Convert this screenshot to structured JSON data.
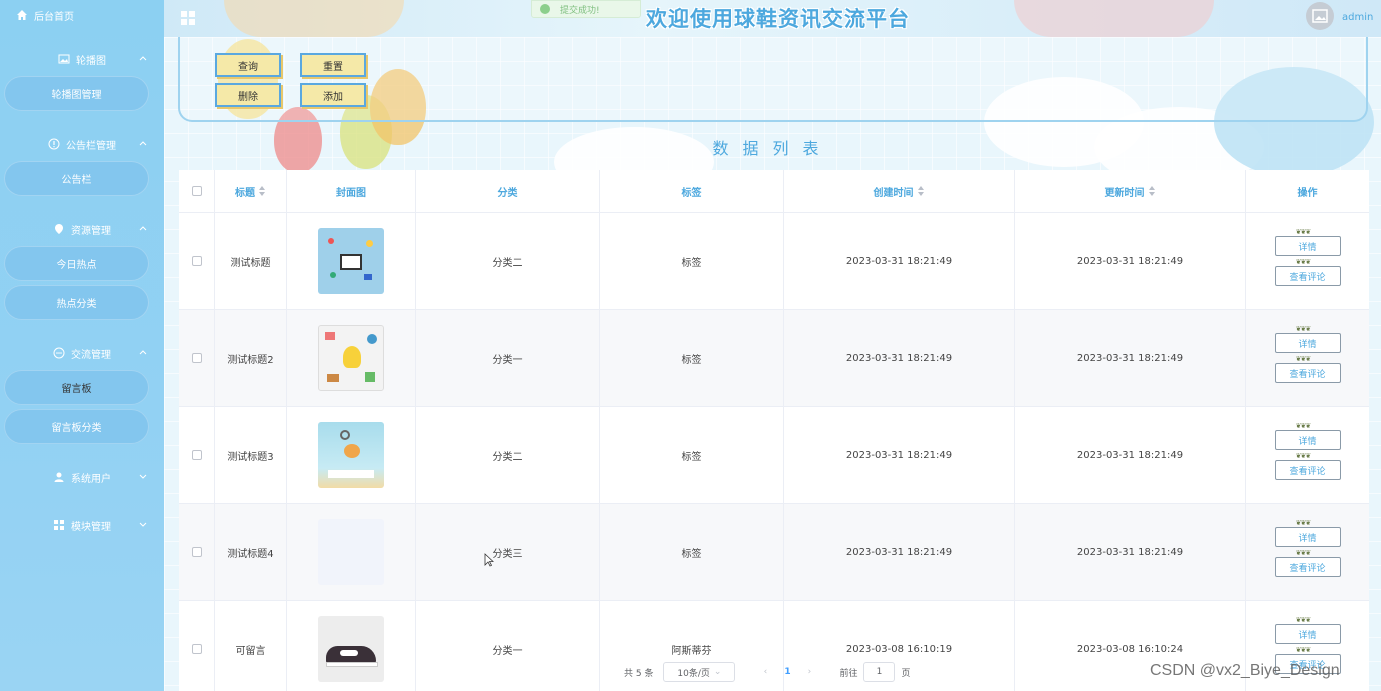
{
  "sidebar": {
    "home": "后台首页",
    "menus": [
      {
        "label": "轮播图",
        "items": [
          "轮播图管理"
        ]
      },
      {
        "label": "公告栏管理",
        "items": [
          "公告栏"
        ]
      },
      {
        "label": "资源管理",
        "items": [
          "今日热点",
          "热点分类"
        ]
      },
      {
        "label": "交流管理",
        "items": [
          "留言板",
          "留言板分类"
        ]
      },
      {
        "label": "系统用户",
        "items": []
      },
      {
        "label": "模块管理",
        "items": []
      }
    ]
  },
  "header": {
    "title": "欢迎使用球鞋资讯交流平台",
    "toast": "提交成功!",
    "username": "admin"
  },
  "search": {
    "query": "查询",
    "reset": "重置",
    "delete": "删除",
    "add": "添加"
  },
  "list_title": "数据列表",
  "table": {
    "headers": [
      "标题",
      "封面图",
      "分类",
      "标签",
      "创建时间",
      "更新时间",
      "操作"
    ],
    "rows": [
      {
        "title": "测试标题",
        "category": "分类二",
        "tag": "标签",
        "created": "2023-03-31 18:21:49",
        "updated": "2023-03-31 18:21:49"
      },
      {
        "title": "测试标题2",
        "category": "分类一",
        "tag": "标签",
        "created": "2023-03-31 18:21:49",
        "updated": "2023-03-31 18:21:49"
      },
      {
        "title": "测试标题3",
        "category": "分类二",
        "tag": "标签",
        "created": "2023-03-31 18:21:49",
        "updated": "2023-03-31 18:21:49"
      },
      {
        "title": "测试标题4",
        "category": "分类三",
        "tag": "标签",
        "created": "2023-03-31 18:21:49",
        "updated": "2023-03-31 18:21:49"
      },
      {
        "title": "可留言",
        "category": "分类一",
        "tag": "阿斯蒂芬",
        "created": "2023-03-08 16:10:19",
        "updated": "2023-03-08 16:10:24"
      }
    ],
    "detail_label": "详情",
    "comment_label": "查看评论"
  },
  "pager": {
    "total": "共 5 条",
    "size": "10条/页",
    "current": "1",
    "goto": "前往",
    "goto_value": "1",
    "page_unit": "页"
  },
  "watermark": "CSDN @vx2_Biye_Design"
}
